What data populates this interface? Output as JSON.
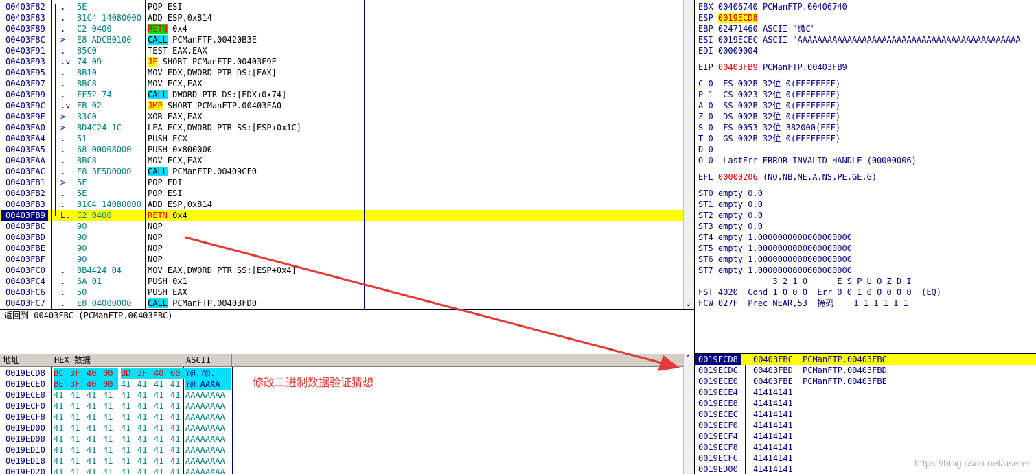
{
  "disasm": {
    "rows": [
      {
        "addr": "00403F82",
        "mark": ".",
        "hex": "5E",
        "asm": "POP ESI"
      },
      {
        "addr": "00403F83",
        "mark": ".",
        "hex": "81C4 14080000",
        "asm": "ADD ESP,0x814"
      },
      {
        "addr": "00403F89",
        "mark": ".",
        "hex": "C2 0400",
        "kw": "RETN",
        "kwstyle": "green",
        "rest": " 0x4"
      },
      {
        "addr": "00403F8C",
        "mark": ">",
        "hex": "E8 ADCB0100",
        "kw": "CALL",
        "kwstyle": "cyan",
        "rest": " PCManFTP.00420B3E"
      },
      {
        "addr": "00403F91",
        "mark": ".",
        "hex": "85C0",
        "asm": "TEST EAX,EAX"
      },
      {
        "addr": "00403F93",
        "mark": ".v",
        "hex": "74 09",
        "kw": "JE",
        "kwstyle": "yellow",
        "rest": " SHORT PCManFTP.00403F9E"
      },
      {
        "addr": "00403F95",
        "mark": ".",
        "hex": "8B10",
        "asm": "MOV EDX,DWORD PTR DS:[EAX]"
      },
      {
        "addr": "00403F97",
        "mark": ".",
        "hex": "8BC8",
        "asm": "MOV ECX,EAX"
      },
      {
        "addr": "00403F99",
        "mark": ".",
        "hex": "FF52 74",
        "kw": "CALL",
        "kwstyle": "cyan",
        "rest": " DWORD PTR DS:[EDX+0x74]"
      },
      {
        "addr": "00403F9C",
        "mark": ".v",
        "hex": "EB 02",
        "kw": "JMP",
        "kwstyle": "yellow",
        "rest": " SHORT PCManFTP.00403FA0"
      },
      {
        "addr": "00403F9E",
        "mark": ">",
        "hex": "33C0",
        "asm": "XOR EAX,EAX"
      },
      {
        "addr": "00403FA0",
        "mark": ">",
        "hex": "8D4C24 1C",
        "asm": "LEA ECX,DWORD PTR SS:[ESP+0x1C]"
      },
      {
        "addr": "00403FA4",
        "mark": ".",
        "hex": "51",
        "asm": "PUSH ECX"
      },
      {
        "addr": "00403FA5",
        "mark": ".",
        "hex": "68 00008000",
        "asm": "PUSH 0x800000"
      },
      {
        "addr": "00403FAA",
        "mark": ".",
        "hex": "8BC8",
        "asm": "MOV ECX,EAX"
      },
      {
        "addr": "00403FAC",
        "mark": ".",
        "hex": "E8 3F5D0000",
        "kw": "CALL",
        "kwstyle": "cyan",
        "rest": " PCManFTP.00409CF0"
      },
      {
        "addr": "00403FB1",
        "mark": ">",
        "hex": "5F",
        "asm": "POP EDI"
      },
      {
        "addr": "00403FB2",
        "mark": ".",
        "hex": "5E",
        "asm": "POP ESI"
      },
      {
        "addr": "00403FB3",
        "mark": ".",
        "hex": "81C4 14080000",
        "asm": "ADD ESP,0x814"
      },
      {
        "addr": "00403FB9",
        "mark": "L.",
        "hex": "C2 0400",
        "kw": "RETN",
        "kwstyle": "yellow",
        "rest": " 0x4",
        "current": true
      },
      {
        "addr": "00403FBC",
        "mark": "",
        "hex": "90",
        "asm": "NOP"
      },
      {
        "addr": "00403FBD",
        "mark": "",
        "hex": "90",
        "asm": "NOP"
      },
      {
        "addr": "00403FBE",
        "mark": "",
        "hex": "90",
        "asm": "NOP"
      },
      {
        "addr": "00403FBF",
        "mark": "",
        "hex": "90",
        "asm": "NOP"
      },
      {
        "addr": "00403FC0",
        "mark": ".",
        "hex": "8B4424 04",
        "asm": "MOV EAX,DWORD PTR SS:[ESP+0x4]"
      },
      {
        "addr": "00403FC4",
        "mark": ".",
        "hex": "6A 01",
        "asm": "PUSH 0x1"
      },
      {
        "addr": "00403FC6",
        "mark": ".",
        "hex": "50",
        "asm": "PUSH EAX"
      },
      {
        "addr": "00403FC7",
        "mark": ".",
        "hex": "E8 04000000",
        "kw": "CALL",
        "kwstyle": "cyan",
        "rest": " PCManFTP.00403FD0"
      }
    ]
  },
  "info": {
    "text": "返回到 00403FBC (PCManFTP.00403FBC)"
  },
  "registers": {
    "lines": [
      {
        "name": "EBX",
        "val": "00406740",
        "cmt": " PCManFTP.00406740"
      },
      {
        "name": "ESP",
        "val": "0019ECD8",
        "cmt": "",
        "style": "yellow"
      },
      {
        "name": "EBP",
        "val": "02471460",
        "cmt": " ASCII \"缴C\""
      },
      {
        "name": "ESI",
        "val": "0019ECEC",
        "cmt": " ASCII \"AAAAAAAAAAAAAAAAAAAAAAAAAAAAAAAAAAAAAAAAAAAAA"
      },
      {
        "name": "EDI",
        "val": "00000004",
        "cmt": ""
      },
      {
        "gap": true
      },
      {
        "name": "EIP",
        "val": "00403FB9",
        "cmt": " PCManFTP.00403FB9",
        "style": "red"
      },
      {
        "gap": true
      },
      {
        "raw": "C 0  ES 002B 32位 0(FFFFFFFF)"
      },
      {
        "raw1": "P ",
        "raw2": "1",
        "raw3": "  CS 0023 32位 0(FFFFFFFF)"
      },
      {
        "raw": "A 0  SS 002B 32位 0(FFFFFFFF)"
      },
      {
        "raw": "Z 0  DS 002B 32位 0(FFFFFFFF)"
      },
      {
        "raw": "S 0  FS 0053 32位 382000(FFF)"
      },
      {
        "raw": "T 0  GS 002B 32位 0(FFFFFFFF)"
      },
      {
        "raw": "D 0"
      },
      {
        "raw": "O 0  LastErr ERROR_INVALID_HANDLE (00000006)"
      },
      {
        "gap": true
      },
      {
        "name": "EFL",
        "val": "00000206",
        "cmt": " (NO,NB,NE,A,NS,PE,GE,G)",
        "style": "red"
      },
      {
        "gap": true
      },
      {
        "raw": "ST0 empty 0.0"
      },
      {
        "raw": "ST1 empty 0.0"
      },
      {
        "raw": "ST2 empty 0.0"
      },
      {
        "raw": "ST3 empty 0.0"
      },
      {
        "raw": "ST4 empty 1.0000000000000000000"
      },
      {
        "raw": "ST5 empty 1.0000000000000000000"
      },
      {
        "raw": "ST6 empty 1.0000000000000000000"
      },
      {
        "raw": "ST7 empty 1.0000000000000000000"
      },
      {
        "raw": "               3 2 1 0      E S P U O Z D I"
      },
      {
        "raw": "FST 4020  Cond 1 0 0 0  Err 0 0 1 0 0 0 0 0  (EQ)"
      },
      {
        "raw": "FCW 027F  Prec NEAR,53  掩码    1 1 1 1 1 1"
      }
    ]
  },
  "dump": {
    "headers": {
      "addr": "地址",
      "hex": "HEX 数据",
      "ascii": "ASCII"
    },
    "rows": [
      {
        "addr": "0019ECD8",
        "bytes": [
          "BC",
          "3F",
          "40",
          "00",
          "BD",
          "3F",
          "40",
          "00"
        ],
        "ascii": "?@.?@.",
        "red": [
          0,
          1,
          2,
          3,
          4,
          5,
          6,
          7
        ],
        "asciiHl": true
      },
      {
        "addr": "0019ECE0",
        "bytes": [
          "BE",
          "3F",
          "40",
          "00",
          "41",
          "41",
          "41",
          "41"
        ],
        "ascii": "?@.AAAA",
        "red": [
          0,
          1,
          2,
          3
        ],
        "asciiHl": true
      },
      {
        "addr": "0019ECE8",
        "bytes": [
          "41",
          "41",
          "41",
          "41",
          "41",
          "41",
          "41",
          "41"
        ],
        "ascii": "AAAAAAAA"
      },
      {
        "addr": "0019ECF0",
        "bytes": [
          "41",
          "41",
          "41",
          "41",
          "41",
          "41",
          "41",
          "41"
        ],
        "ascii": "AAAAAAAA"
      },
      {
        "addr": "0019ECF8",
        "bytes": [
          "41",
          "41",
          "41",
          "41",
          "41",
          "41",
          "41",
          "41"
        ],
        "ascii": "AAAAAAAA"
      },
      {
        "addr": "0019ED00",
        "bytes": [
          "41",
          "41",
          "41",
          "41",
          "41",
          "41",
          "41",
          "41"
        ],
        "ascii": "AAAAAAAA"
      },
      {
        "addr": "0019ED08",
        "bytes": [
          "41",
          "41",
          "41",
          "41",
          "41",
          "41",
          "41",
          "41"
        ],
        "ascii": "AAAAAAAA"
      },
      {
        "addr": "0019ED10",
        "bytes": [
          "41",
          "41",
          "41",
          "41",
          "41",
          "41",
          "41",
          "41"
        ],
        "ascii": "AAAAAAAA"
      },
      {
        "addr": "0019ED18",
        "bytes": [
          "41",
          "41",
          "41",
          "41",
          "41",
          "41",
          "41",
          "41"
        ],
        "ascii": "AAAAAAAA"
      },
      {
        "addr": "0019ED20",
        "bytes": [
          "41",
          "41",
          "41",
          "41",
          "41",
          "41",
          "41",
          "41"
        ],
        "ascii": "AAAAAAAA"
      }
    ]
  },
  "annotation": {
    "text": "修改二进制数据验证猜想",
    "color": "#e53935"
  },
  "stack": {
    "rows": [
      {
        "addr": "0019ECD8",
        "val": "00403FBC",
        "cmt": "PCManFTP.00403FBC",
        "current": true
      },
      {
        "addr": "0019ECDC",
        "val": "00403FBD",
        "cmt": "PCManFTP.00403FBD"
      },
      {
        "addr": "0019ECE0",
        "val": "00403FBE",
        "cmt": "PCManFTP.00403FBE"
      },
      {
        "addr": "0019ECE4",
        "val": "41414141",
        "cmt": ""
      },
      {
        "addr": "0019ECE8",
        "val": "41414141",
        "cmt": ""
      },
      {
        "addr": "0019ECEC",
        "val": "41414141",
        "cmt": ""
      },
      {
        "addr": "0019ECF0",
        "val": "41414141",
        "cmt": ""
      },
      {
        "addr": "0019ECF4",
        "val": "41414141",
        "cmt": ""
      },
      {
        "addr": "0019ECF8",
        "val": "41414141",
        "cmt": ""
      },
      {
        "addr": "0019ECFC",
        "val": "41414141",
        "cmt": ""
      },
      {
        "addr": "0019ED00",
        "val": "41414141",
        "cmt": ""
      }
    ]
  },
  "watermark": {
    "text": "https://blog.csdn.net/userer"
  }
}
